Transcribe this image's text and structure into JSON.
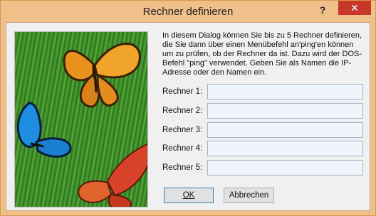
{
  "titlebar": {
    "title": "Rechner definieren",
    "help_label": "?",
    "close_label": "✕"
  },
  "info_text": "In diesem Dialog können Sie bis zu 5 Rechner definieren, die Sie dann über einen Menübefehl an'ping'en können um zu prüfen, ob der Rechner da ist. Dazu wird der DOS-Befehl \"ping\" verwendet. Geben Sie als Namen die IP-Adresse oder den Namen ein.",
  "fields": [
    {
      "label": "Rechner 1:",
      "value": ""
    },
    {
      "label": "Rechner 2:",
      "value": ""
    },
    {
      "label": "Rechner 3:",
      "value": ""
    },
    {
      "label": "Rechner 4:",
      "value": ""
    },
    {
      "label": "Rechner 5:",
      "value": ""
    }
  ],
  "buttons": {
    "ok_label": "OK",
    "cancel_label": "Abbrechen"
  },
  "colors": {
    "titlebar": "#f0c08a",
    "close_button": "#c7372a",
    "input_background": "#f0f5fb"
  }
}
